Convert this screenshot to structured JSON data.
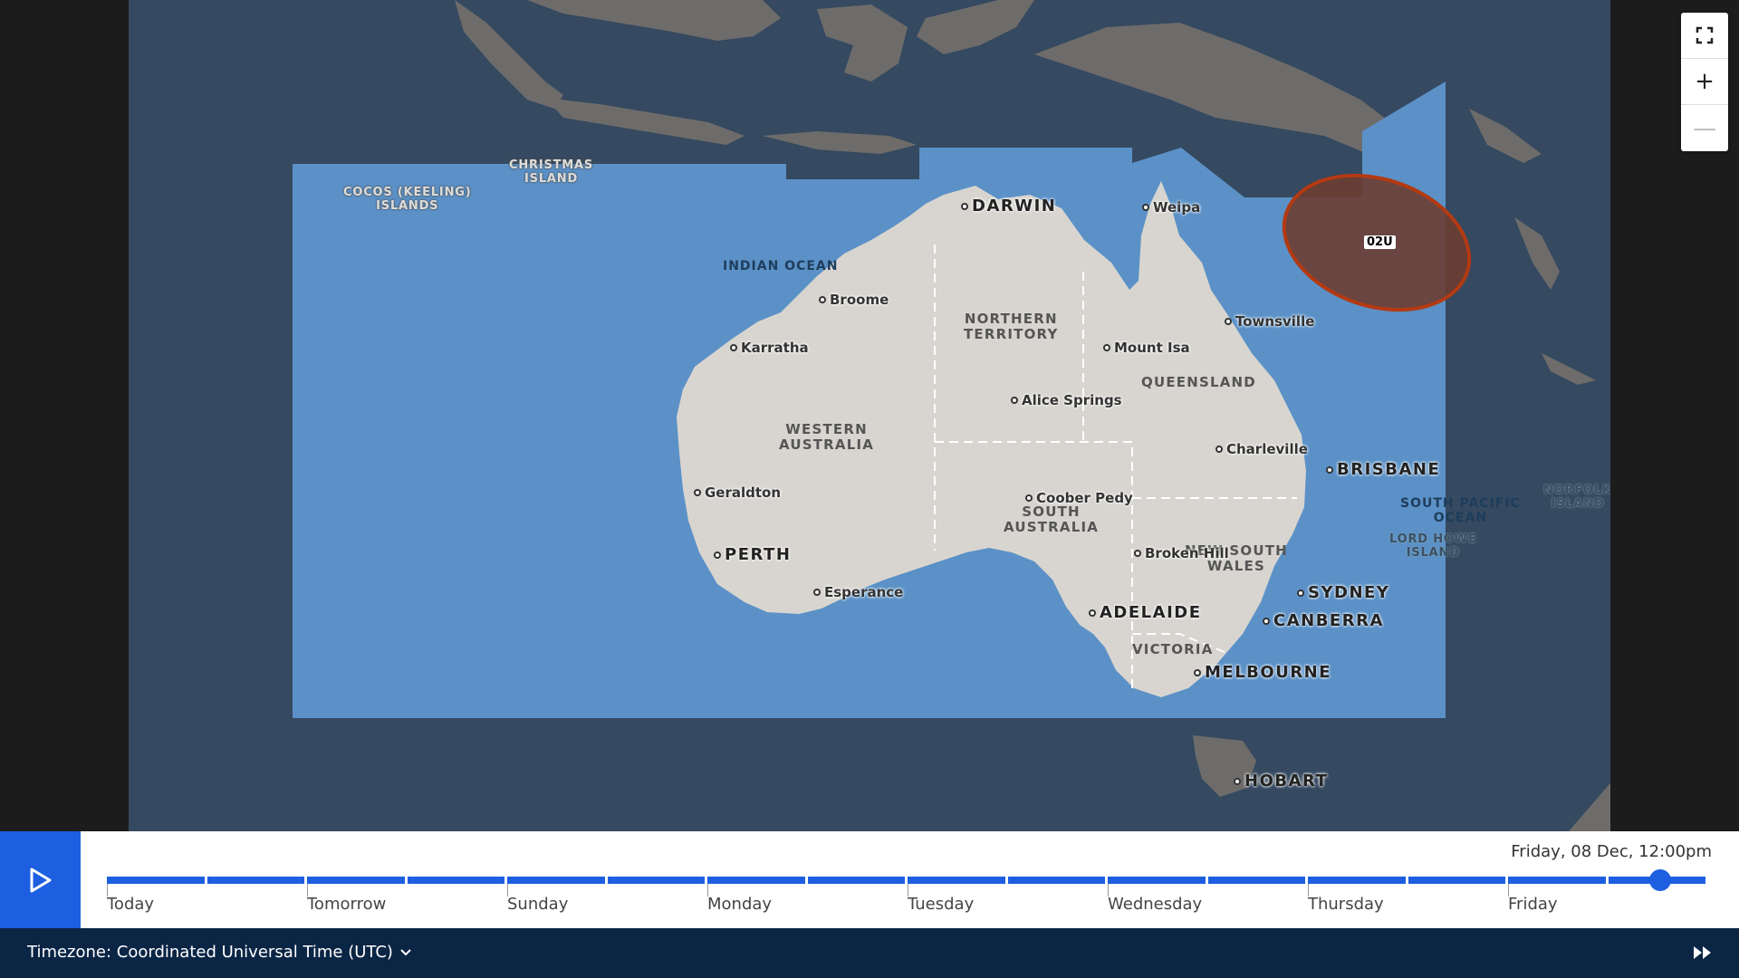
{
  "map": {
    "storm": {
      "label": "02U"
    },
    "oceans": [
      {
        "id": "indian-ocean",
        "label": "INDIAN OCEAN"
      },
      {
        "id": "south-pacific-ocean",
        "label": "SOUTH PACIFIC\nOCEAN"
      }
    ],
    "islands": [
      {
        "id": "cocos",
        "label": "COCOS (KEELING)\nISLANDS"
      },
      {
        "id": "christmas",
        "label": "CHRISTMAS\nISLAND"
      },
      {
        "id": "lord-howe",
        "label": "LORD HOWE\nISLAND"
      },
      {
        "id": "norfolk",
        "label": "NORFOLK\nISLAND"
      }
    ],
    "regions": [
      {
        "id": "northern-territory",
        "label": "NORTHERN\nTERRITORY"
      },
      {
        "id": "queensland",
        "label": "QUEENSLAND"
      },
      {
        "id": "western-australia",
        "label": "WESTERN\nAUSTRALIA"
      },
      {
        "id": "south-australia",
        "label": "SOUTH\nAUSTRALIA"
      },
      {
        "id": "new-south-wales",
        "label": "NEW SOUTH\nWALES"
      },
      {
        "id": "victoria",
        "label": "VICTORIA"
      }
    ],
    "cities": [
      {
        "id": "darwin",
        "label": "DARWIN",
        "major": true
      },
      {
        "id": "weipa",
        "label": "Weipa"
      },
      {
        "id": "broome",
        "label": "Broome"
      },
      {
        "id": "karratha",
        "label": "Karratha"
      },
      {
        "id": "townsville",
        "label": "Townsville"
      },
      {
        "id": "mount-isa",
        "label": "Mount Isa"
      },
      {
        "id": "alice-springs",
        "label": "Alice Springs"
      },
      {
        "id": "charleville",
        "label": "Charleville"
      },
      {
        "id": "brisbane",
        "label": "BRISBANE",
        "major": true
      },
      {
        "id": "geraldton",
        "label": "Geraldton"
      },
      {
        "id": "coober-pedy",
        "label": "Coober Pedy"
      },
      {
        "id": "perth",
        "label": "PERTH",
        "major": true
      },
      {
        "id": "broken-hill",
        "label": "Broken Hill"
      },
      {
        "id": "esperance",
        "label": "Esperance"
      },
      {
        "id": "sydney",
        "label": "SYDNEY",
        "major": true
      },
      {
        "id": "adelaide",
        "label": "ADELAIDE",
        "major": true
      },
      {
        "id": "canberra",
        "label": "CANBERRA",
        "major": true
      },
      {
        "id": "melbourne",
        "label": "MELBOURNE",
        "major": true
      },
      {
        "id": "hobart",
        "label": "HOBART",
        "major": true
      }
    ],
    "colors": {
      "sea": "#354960",
      "land": "#6e6c6a",
      "forecast_area": "#5b91c7",
      "australia": "#d8d5d0",
      "storm_fill": "#6b3d32",
      "storm_stroke": "#b33a12"
    }
  },
  "controls": {
    "fullscreen_icon": "fullscreen-icon",
    "zoom_in": "+",
    "zoom_out": "—"
  },
  "timeline": {
    "current_time": "Friday, 08 Dec, 12:00pm",
    "progress": 0.97,
    "days": [
      "Today",
      "Tomorrow",
      "Sunday",
      "Monday",
      "Tuesday",
      "Wednesday",
      "Thursday",
      "Friday"
    ],
    "segments_per_day": 2
  },
  "footer": {
    "timezone_label": "Timezone: Coordinated Universal Time (UTC)"
  }
}
